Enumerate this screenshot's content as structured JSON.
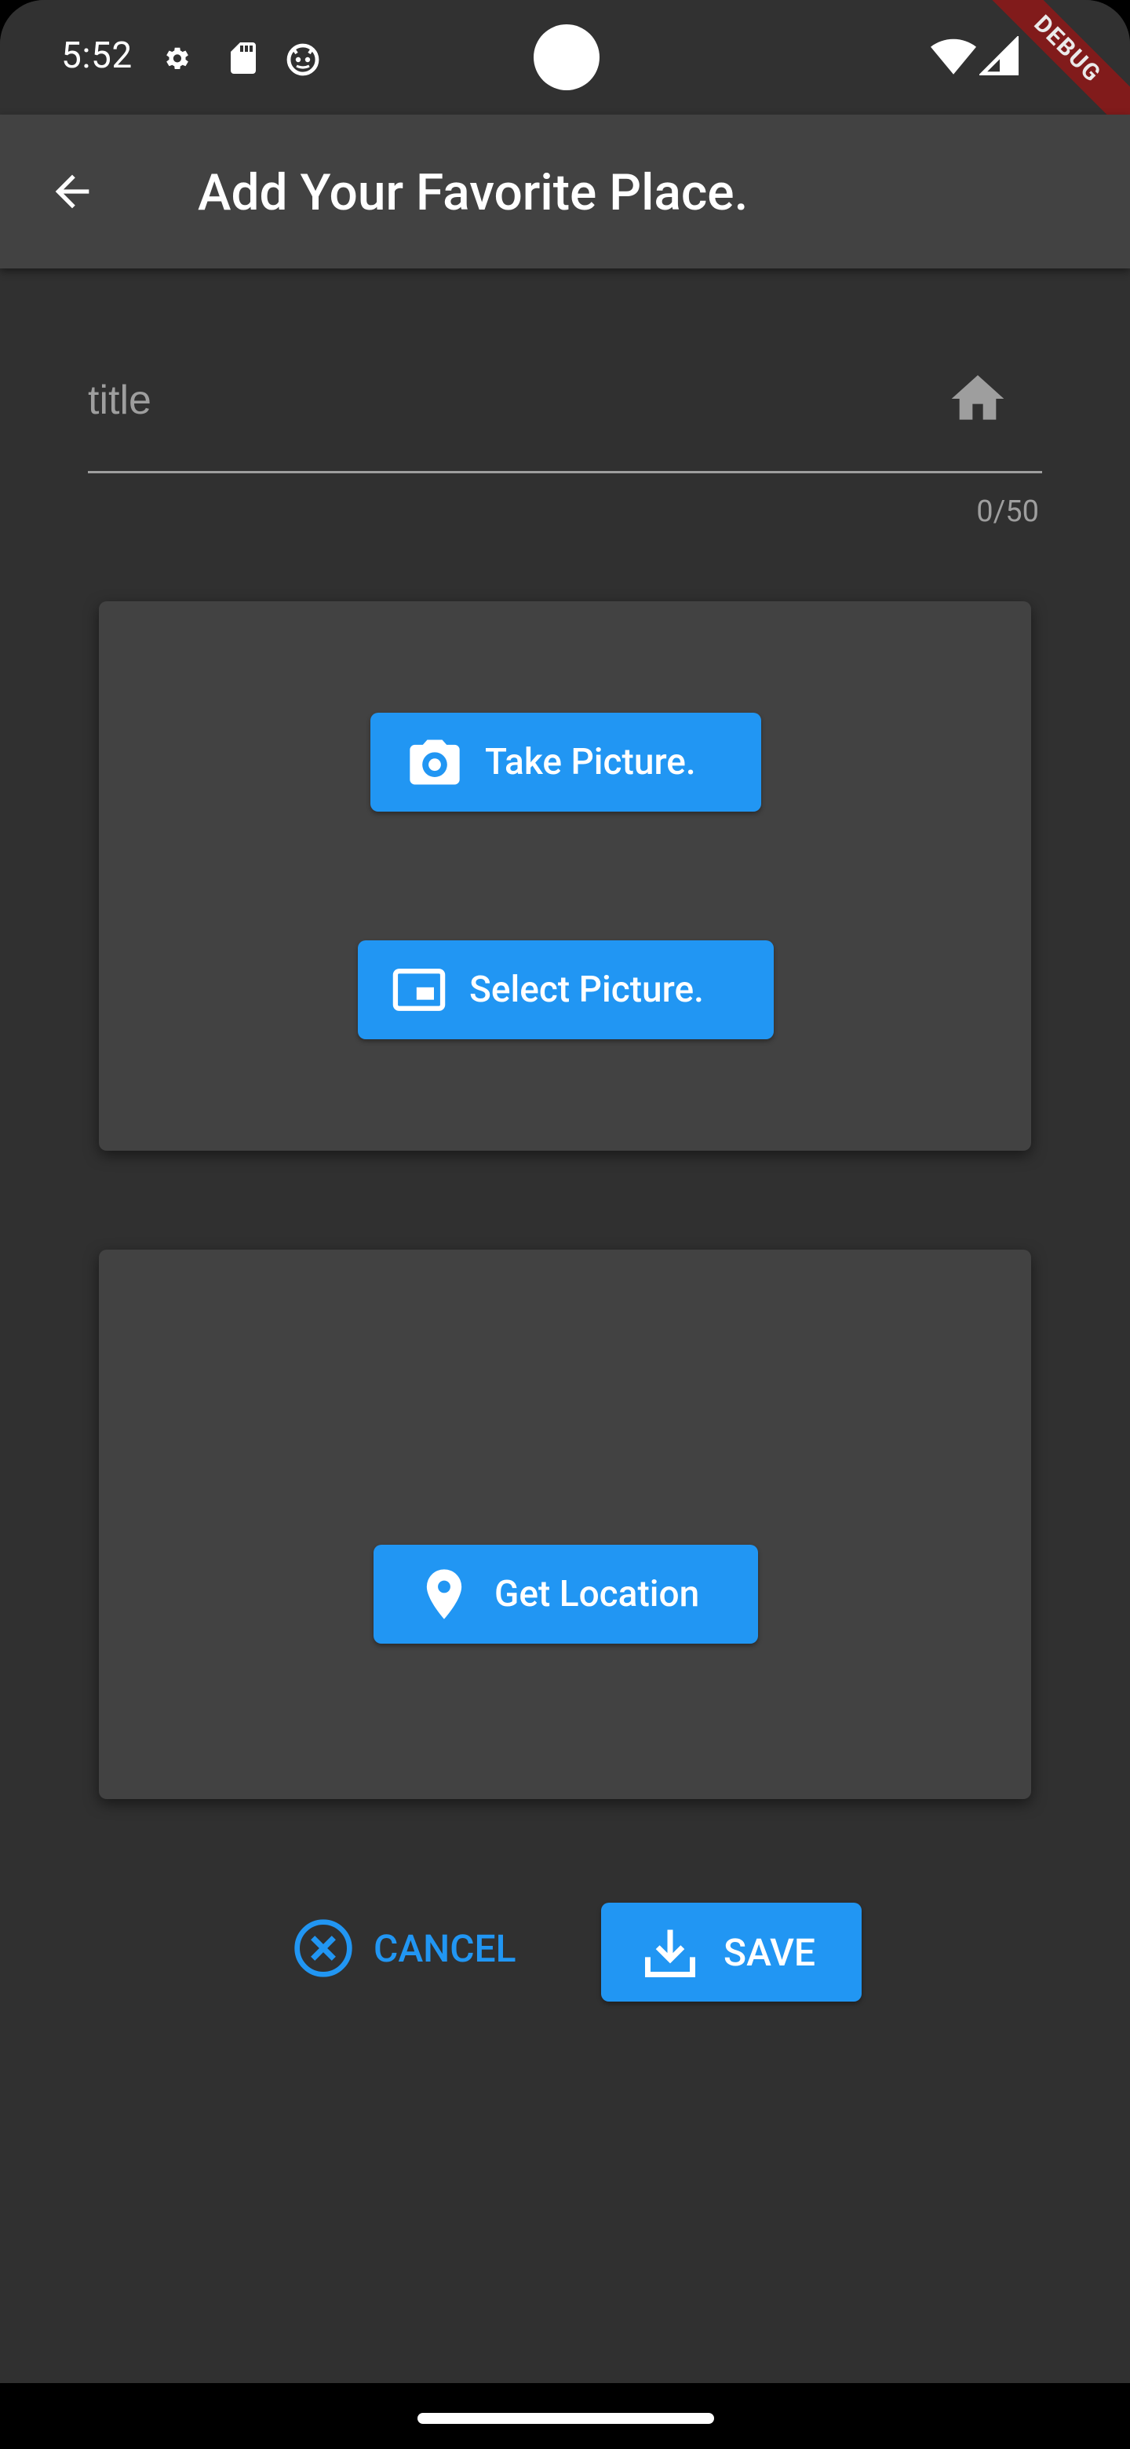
{
  "status_bar": {
    "time": "5:52",
    "icons": [
      "settings-icon",
      "sd-card-icon",
      "android-face-icon",
      "wifi-icon",
      "signal-icon"
    ],
    "debug_label": "DEBUG"
  },
  "app_bar": {
    "title": "Add Your Favorite Place.",
    "back_icon": "arrow-back-icon"
  },
  "title_field": {
    "placeholder": "title",
    "value": "",
    "counter": "0/50",
    "icon": "home-icon"
  },
  "picture_card": {
    "take_label": "Take Picture.",
    "select_label": "Select Picture."
  },
  "location_card": {
    "location_label": "Get Location"
  },
  "actions": {
    "cancel_label": "CANCEL",
    "save_label": "SAVE"
  },
  "colors": {
    "background": "#303030",
    "app_bar": "#424242",
    "card": "#424242",
    "accent": "#2196f3"
  }
}
